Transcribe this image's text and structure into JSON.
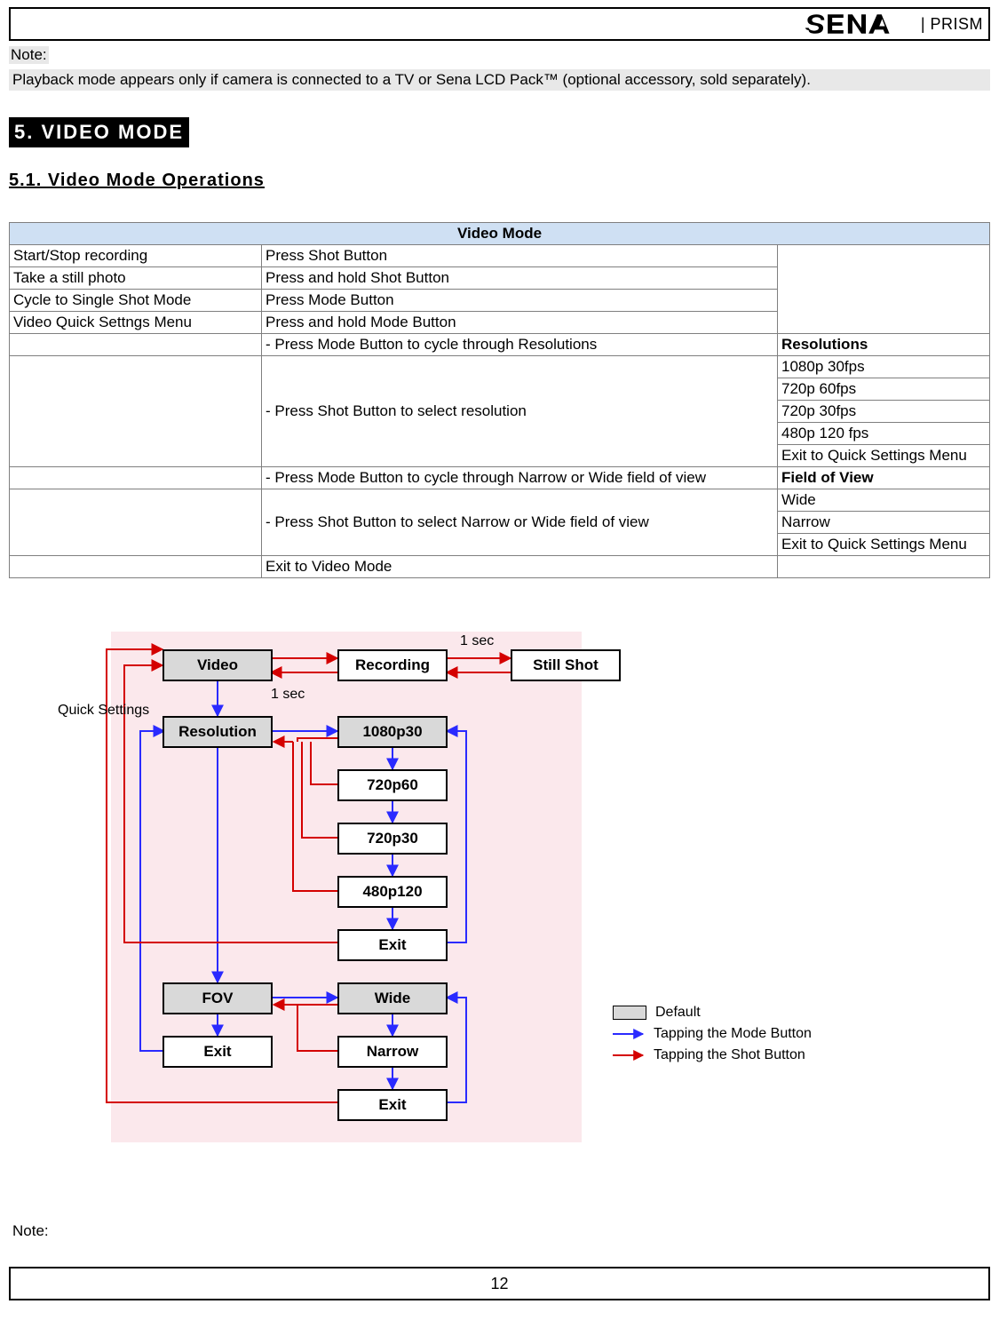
{
  "header": {
    "brand_suffix": "| PRISM"
  },
  "note": {
    "label": "Note:",
    "body": "Playback mode appears only if camera is connected to a TV or Sena LCD Pack™ (optional accessory, sold separately)."
  },
  "section": {
    "h5": "5. VIDEO MODE",
    "h51": "5.1. Video Mode Operations"
  },
  "table": {
    "title": "Video Mode",
    "r1a": "Start/Stop recording",
    "r1b": "Press Shot Button",
    "r2a": "Take a still photo",
    "r2b": "Press and hold Shot Button",
    "r3a": "Cycle to Single Shot Mode",
    "r3b": "Press Mode Button",
    "r4a": "Video Quick Settngs Menu",
    "r4b": "Press and hold Mode Button",
    "r5b": "- Press Mode Button to cycle through Resolutions",
    "r5c": "Resolutions",
    "r6b": "- Press Shot Button to select resolution",
    "r6c1": "1080p 30fps",
    "r6c2": "720p 60fps",
    "r6c3": "720p 30fps",
    "r6c4": "480p 120 fps",
    "r6c5": "Exit to Quick Settings Menu",
    "r7b": "- Press Mode Button to cycle through Narrow or Wide field of view",
    "r7c": "Field of View",
    "r8b": "- Press Shot Button to select Narrow or Wide field of view",
    "r8c1": "Wide",
    "r8c2": "Narrow",
    "r8c3": "Exit to Quick Settings Menu",
    "r9b": "Exit to Video Mode"
  },
  "diagram": {
    "video": "Video",
    "recording": "Recording",
    "still": "Still Shot",
    "qs": "Quick Settings",
    "onesec": "1 sec",
    "resolution": "Resolution",
    "r1080": "1080p30",
    "r720_60": "720p60",
    "r720_30": "720p30",
    "r480": "480p120",
    "fov": "FOV",
    "wide": "Wide",
    "narrow": "Narrow",
    "exit": "Exit"
  },
  "legend": {
    "default": "Default",
    "mode": "Tapping the Mode Button",
    "shot": "Tapping the Shot Button"
  },
  "bottom_note": "Note:",
  "page_no": "12",
  "colors": {
    "blue": "#2a2aff",
    "red": "#d40000"
  }
}
